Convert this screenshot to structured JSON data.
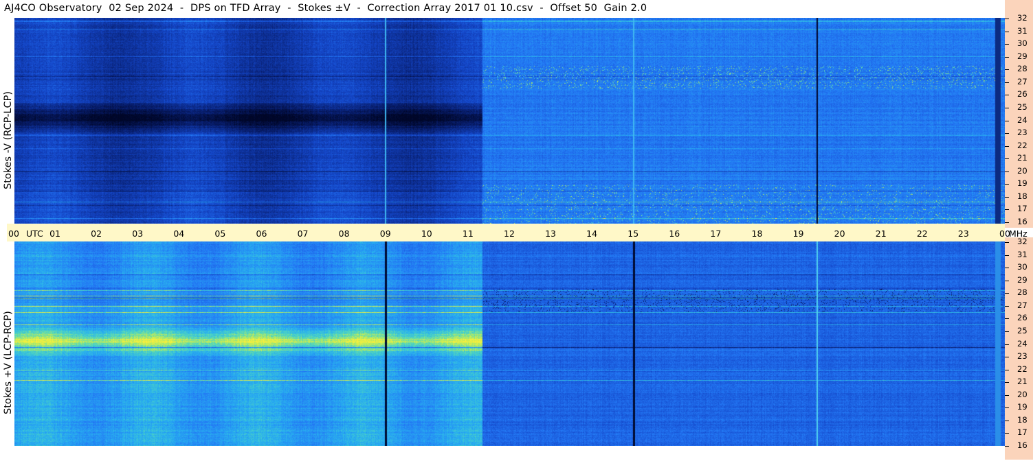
{
  "title": "AJ4CO Observatory  02 Sep 2024  -  DPS on TFD Array  -  Stokes ±V  -  Correction Array 2017 01 10.csv  -  Offset 50  Gain 2.0",
  "time_axis": {
    "ticks": [
      "00",
      "01",
      "02",
      "03",
      "04",
      "05",
      "06",
      "07",
      "08",
      "09",
      "10",
      "11",
      "12",
      "13",
      "14",
      "15",
      "16",
      "17",
      "18",
      "19",
      "20",
      "21",
      "22",
      "23",
      "00"
    ],
    "utc_label": "UTC",
    "mhz_label": "MHz"
  },
  "panels": [
    {
      "ylabel": "Stokes -V  (RCP-LCP)"
    },
    {
      "ylabel": "Stokes +V  (LCP-RCP)"
    }
  ],
  "chart_data": {
    "type": "heatmap",
    "title": "AJ4CO Observatory  02 Sep 2024  -  DPS on TFD Array  -  Stokes ±V  -  Correction Array 2017 01 10.csv  -  Offset 50  Gain 2.0",
    "x_ticks": [
      "00",
      "01",
      "02",
      "03",
      "04",
      "05",
      "06",
      "07",
      "08",
      "09",
      "10",
      "11",
      "12",
      "13",
      "14",
      "15",
      "16",
      "17",
      "18",
      "19",
      "20",
      "21",
      "22",
      "23",
      "00"
    ],
    "xlabel": "UTC",
    "ylabel_unit": "MHz",
    "freq_ticks": [
      32,
      31,
      30,
      29,
      28,
      27,
      26,
      25,
      24,
      23,
      22,
      21,
      20,
      19,
      18,
      17,
      16
    ],
    "ylim": [
      16,
      32
    ],
    "xlim_hours": [
      0,
      24
    ],
    "panels": [
      "Stokes -V  (RCP-LCP)",
      "Stokes +V  (LCP-RCP)"
    ],
    "colors": {
      "low": "#000a3a",
      "mid": "#1e5cf0",
      "high": "#f0f040"
    }
  }
}
